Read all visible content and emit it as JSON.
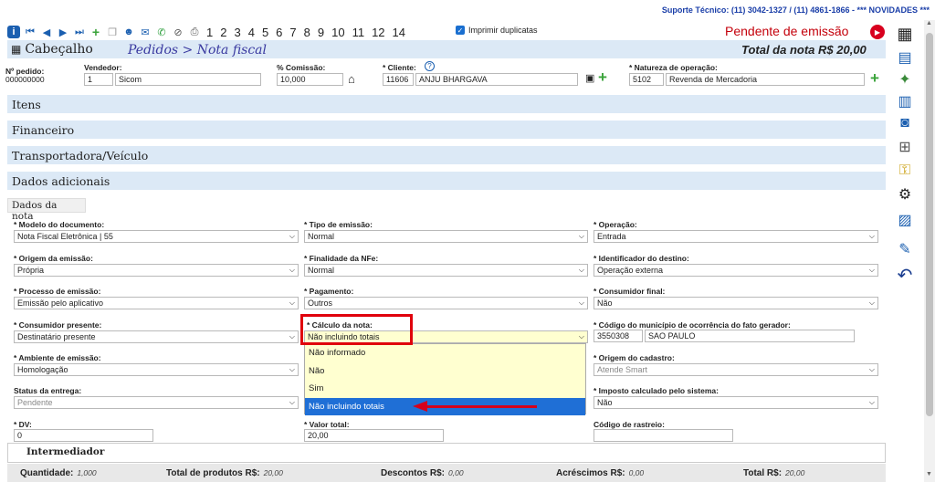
{
  "support": {
    "text": "Suporte Técnico: (11) 3042-1327 / (11) 4861-1866 - *** NOVIDADES ***"
  },
  "toolbar": {
    "pages": [
      "1",
      "2",
      "3",
      "4",
      "5",
      "6",
      "7",
      "8",
      "9",
      "10",
      "11",
      "12",
      "14"
    ],
    "print_duplicates": "Imprimir duplicatas"
  },
  "status": {
    "pending": "Pendente de emissão"
  },
  "header": {
    "title": "Cabeçalho",
    "breadcrumb": "Pedidos > Nota fiscal",
    "total": "Total da nota R$ 20,00"
  },
  "order": {
    "order_no_label": "Nº pedido:",
    "order_no": "000000000",
    "seller_label": "Vendedor:",
    "seller_id": "1",
    "seller_name": "Sicom",
    "commission_label": "% Comissão:",
    "commission": "10,000",
    "client_label": "* Cliente:",
    "client_id": "11606",
    "client_name": "ANJU BHARGAVA",
    "nature_label": "* Natureza de operação:",
    "nature_code": "5102",
    "nature_name": "Revenda de Mercadoria"
  },
  "sections": {
    "items": "Itens",
    "financial": "Financeiro",
    "carrier": "Transportadora/Veículo",
    "extra": "Dados adicionais",
    "tab": "Dados da nota"
  },
  "fields": {
    "modelo_label": "* Modelo do documento:",
    "modelo": "Nota Fiscal Eletrônica | 55",
    "tipo_label": "* Tipo de emissão:",
    "tipo": "Normal",
    "operacao_label": "* Operação:",
    "operacao": "Entrada",
    "origem_label": "* Origem da emissão:",
    "origem": "Própria",
    "finalidade_label": "* Finalidade da NFe:",
    "finalidade": "Normal",
    "destino_label": "* Identificador do destino:",
    "destino": "Operação externa",
    "processo_label": "* Processo de emissão:",
    "processo": "Emissão pelo aplicativo",
    "pagamento_label": "* Pagamento:",
    "pagamento": "Outros",
    "consfinal_label": "* Consumidor final:",
    "consfinal": "Não",
    "conspres_label": "* Consumidor presente:",
    "conspres": "Destinatário presente",
    "calculo_label": "* Cálculo da nota:",
    "calculo": "Não incluindo totais",
    "municipio_label": "* Código do município de ocorrência do fato gerador:",
    "municipio_code": "3550308",
    "municipio_name": "SAO PAULO",
    "ambiente_label": "* Ambiente de emissão:",
    "ambiente": "Homologação",
    "origcad_label": "* Origem do cadastro:",
    "origcad": "Atende Smart",
    "entrega_label": "Status da entrega:",
    "entrega": "Pendente",
    "imposto_label": "* Imposto calculado pelo sistema:",
    "imposto": "Não",
    "dv_label": "* DV:",
    "dv": "0",
    "valor_label": "* Valor total:",
    "valor": "20,00",
    "rastreio_label": "Código de rastreio:",
    "rastreio": ""
  },
  "dropdown": {
    "options": [
      "Não informado",
      "Não",
      "Sim",
      "Não incluindo totais"
    ]
  },
  "intermediador": "Intermediador",
  "footer": {
    "qty_label": "Quantidade:",
    "qty": "1,000",
    "products_label": "Total de produtos R$:",
    "products": "20,00",
    "discount_label": "Descontos R$:",
    "discount": "0,00",
    "surcharge_label": "Acréscimos R$:",
    "surcharge": "0,00",
    "total_label": "Total R$:",
    "total": "20,00"
  }
}
